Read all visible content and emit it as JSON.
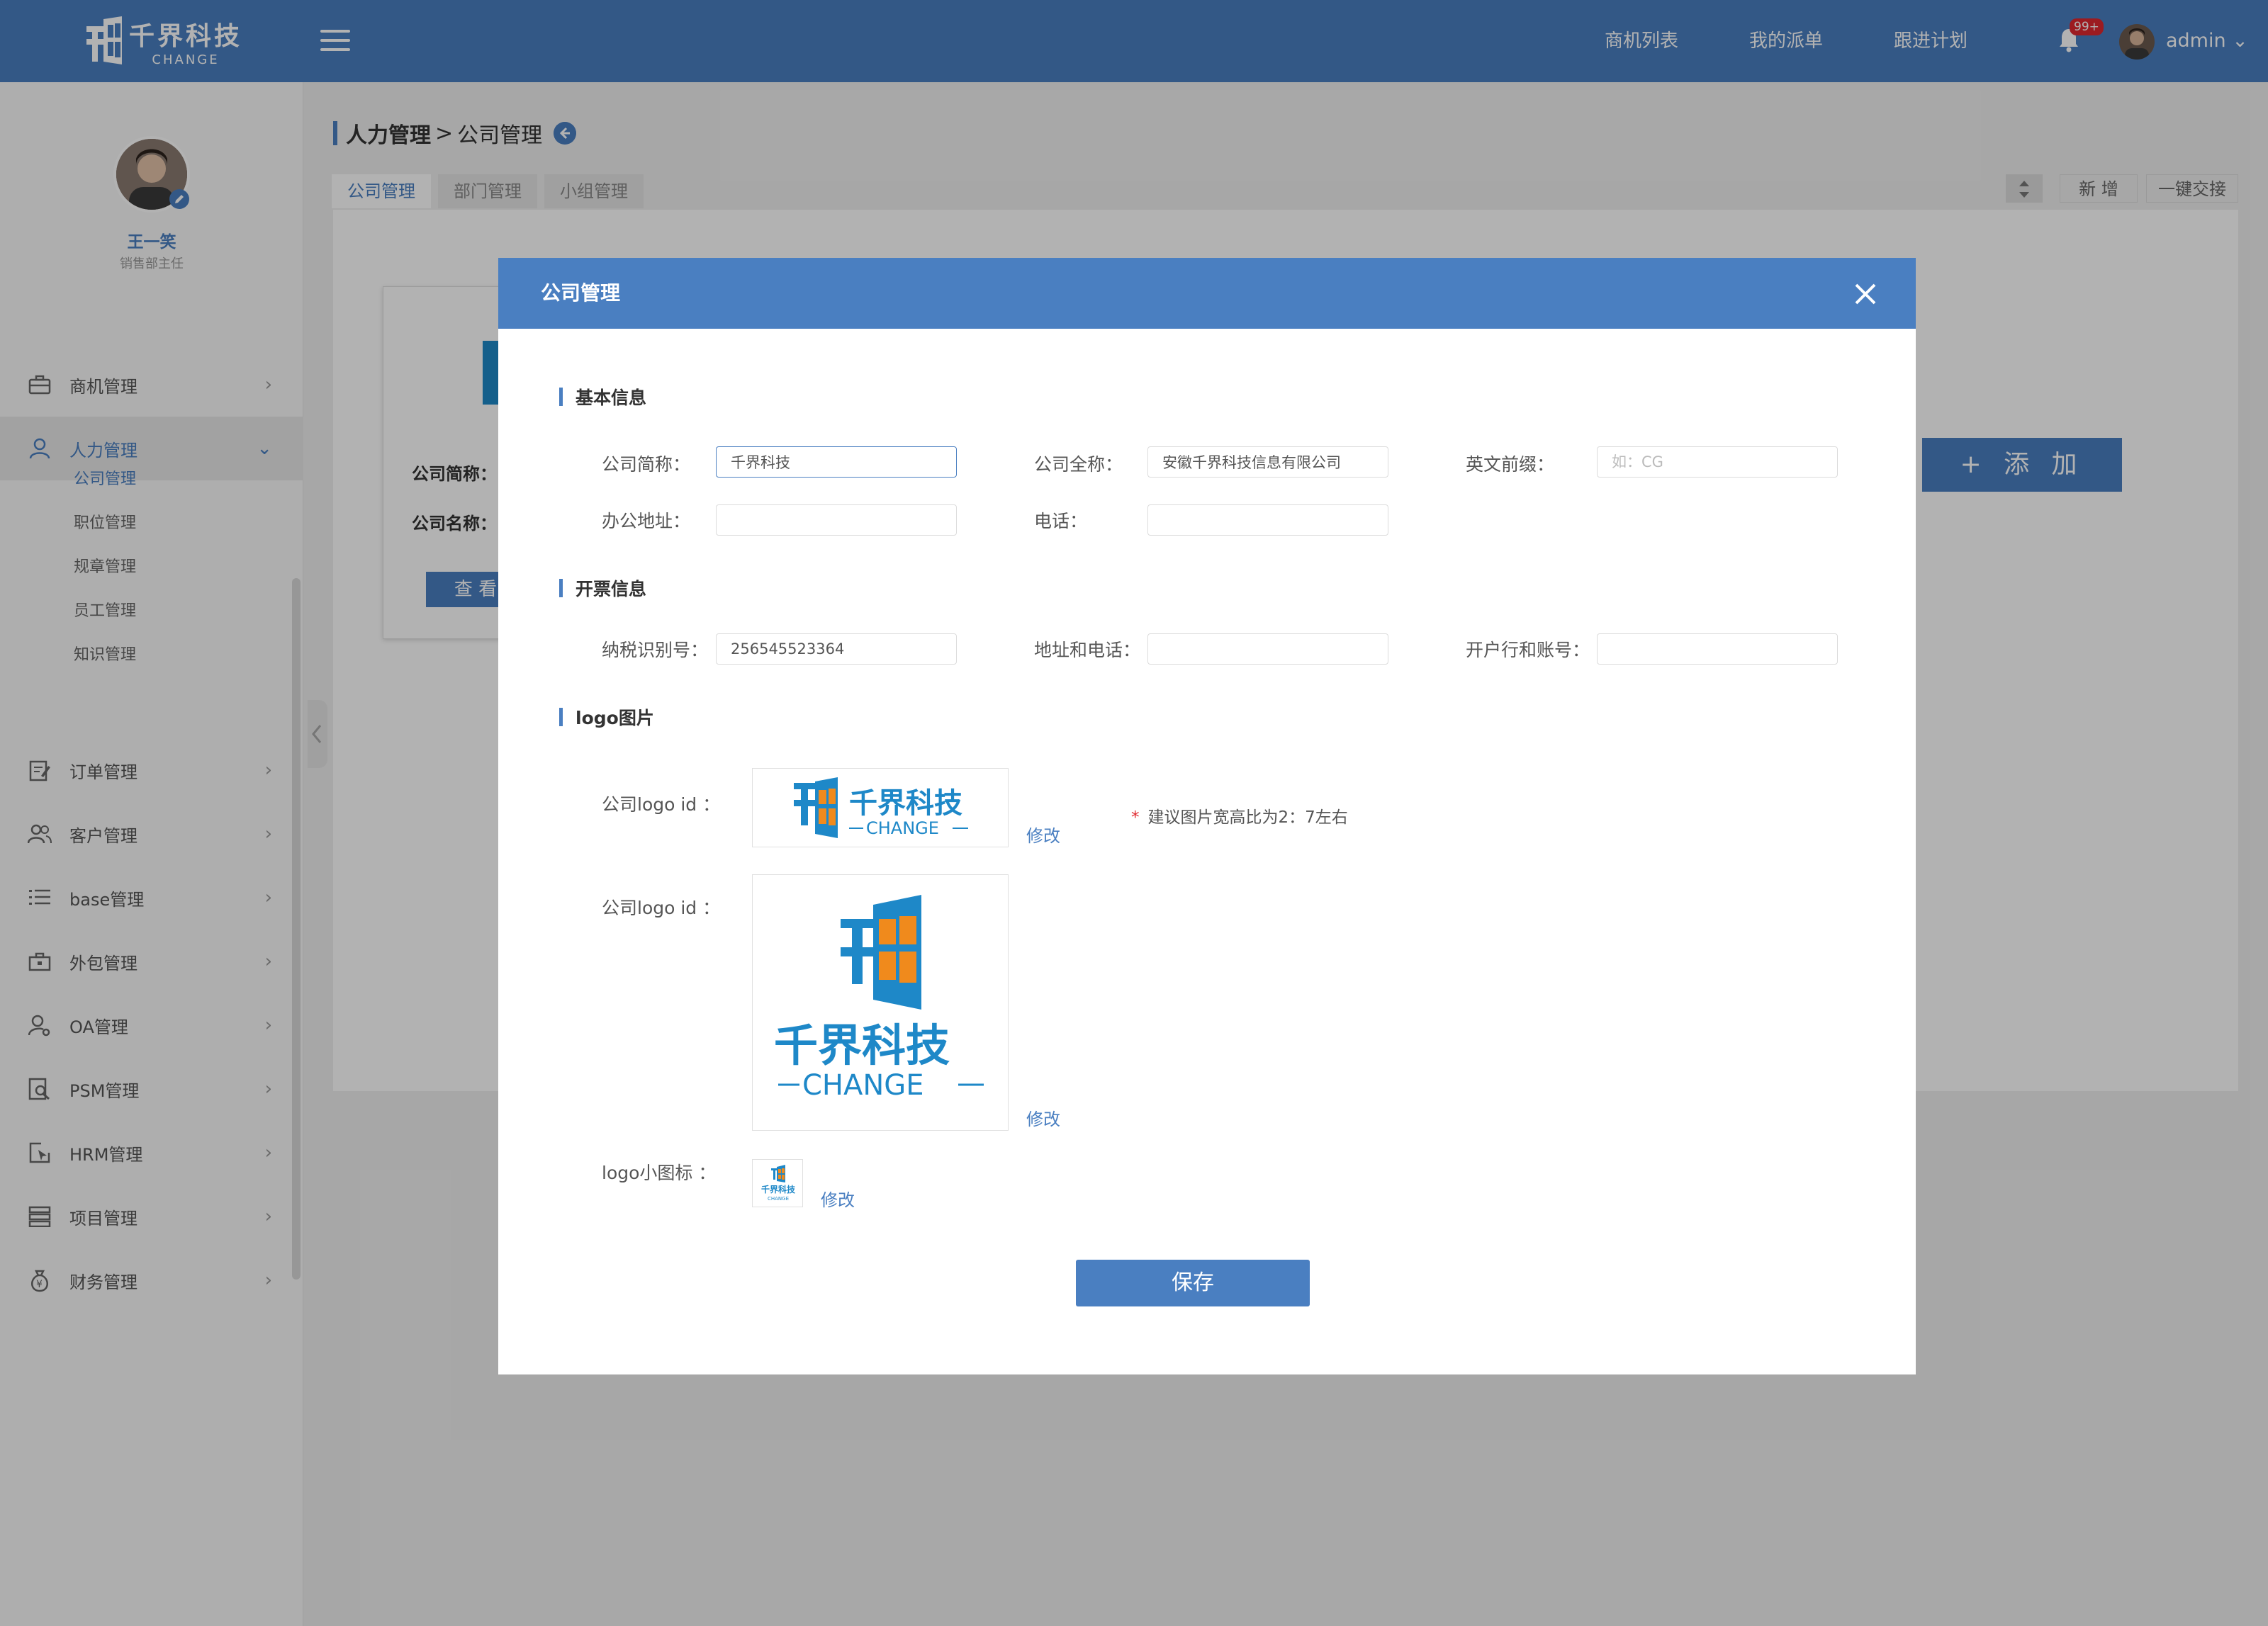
{
  "app": {
    "logo_cn": "千界科技",
    "logo_en": "CHANGE",
    "brand_color": "#4a7fc1"
  },
  "topbar": {
    "nav": [
      "商机列表",
      "我的派单",
      "跟进计划"
    ],
    "notification_badge": "99+",
    "user": "admin"
  },
  "sidebar": {
    "user_name": "王一笑",
    "user_role": "销售部主任",
    "menu": [
      {
        "label": "商机管理",
        "icon": "briefcase-icon"
      },
      {
        "label": "人力管理",
        "icon": "user-icon"
      },
      {
        "label": "订单管理",
        "icon": "edit-doc-icon"
      },
      {
        "label": "客户管理",
        "icon": "users-icon"
      },
      {
        "label": "base管理",
        "icon": "list-icon"
      },
      {
        "label": "外包管理",
        "icon": "toolbox-icon"
      },
      {
        "label": "OA管理",
        "icon": "user-gear-icon"
      },
      {
        "label": "PSM管理",
        "icon": "doc-search-icon"
      },
      {
        "label": "HRM管理",
        "icon": "cursor-box-icon"
      },
      {
        "label": "项目管理",
        "icon": "stack-icon"
      },
      {
        "label": "财务管理",
        "icon": "money-bag-icon"
      }
    ],
    "submenu": [
      "公司管理",
      "职位管理",
      "规章管理",
      "员工管理",
      "知识管理"
    ]
  },
  "breadcrumb": {
    "parent": "人力管理",
    "separator": ">",
    "current": "公司管理"
  },
  "tabs": [
    "公司管理",
    "部门管理",
    "小组管理"
  ],
  "toolbar": {
    "add": "新 增",
    "handover": "一键交接"
  },
  "card": {
    "short_name_label": "公司简称：",
    "full_name_label": "公司名称：",
    "view_btn": "查 看"
  },
  "add_button": "添 加",
  "modal": {
    "title": "公司管理",
    "sections": {
      "basic": "基本信息",
      "invoice": "开票信息",
      "logo": "logo图片"
    },
    "fields": {
      "short_name_label": "公司简称：",
      "short_name_value": "千界科技",
      "full_name_label": "公司全称：",
      "full_name_value": "安徽千界科技信息有限公司",
      "prefix_label": "英文前缀：",
      "prefix_placeholder": "如：CG",
      "address_label": "办公地址：",
      "address_value": "",
      "phone_label": "电话：",
      "phone_value": "",
      "tax_id_label": "纳税识别号：",
      "tax_id_value": "256545523364",
      "addr_phone_label": "地址和电话：",
      "addr_phone_value": "",
      "bank_label": "开户行和账号：",
      "bank_value": ""
    },
    "logo": {
      "logo_id_label_1": "公司logo id ：",
      "logo_id_label_2": "公司logo id ：",
      "small_icon_label": "logo小图标 ：",
      "edit": "修改",
      "hint": "建议图片宽高比为2：7左右",
      "hint_star": "*",
      "logo_cn": "千界科技",
      "logo_en": "CHANGE"
    },
    "save": "保存"
  }
}
